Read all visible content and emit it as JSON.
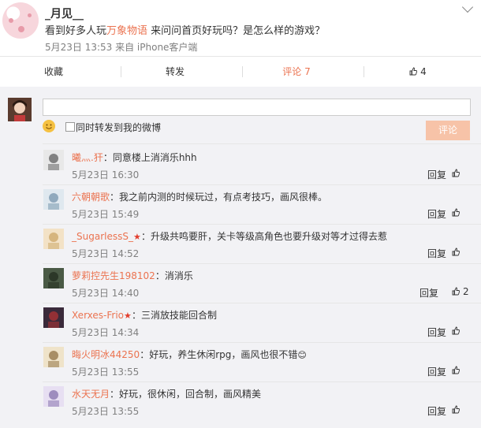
{
  "post": {
    "username": "_月见__",
    "text_before": "看到好多人玩",
    "text_highlight": "万象物语",
    "text_after": " 来问问首页好玩吗？是怎么样的游戏？",
    "meta": "5月23日 13:53 来自 iPhone客户端"
  },
  "actions": {
    "favorite": "收藏",
    "repost": "转发",
    "comment": "评论 7",
    "like_count": "4"
  },
  "composer": {
    "placeholder": "",
    "forward_label": "同时转发到我的微博",
    "submit_label": "评论"
  },
  "comments": [
    {
      "user": "曦灬.犴",
      "vip": false,
      "text": "：同意楼上消消乐hhh",
      "time": "5月23日 16:30",
      "reply": "回复",
      "likes": ""
    },
    {
      "user": "六朝朝歌",
      "vip": false,
      "text": "：我之前内测的时候玩过，有点考技巧，画风很棒。",
      "time": "5月23日 15:49",
      "reply": "回复",
      "likes": ""
    },
    {
      "user": "_SugarlessS_",
      "vip": true,
      "text": "：升级共鸣要肝，关卡等级高角色也要升级对等才过得去惹",
      "time": "5月23日 14:52",
      "reply": "回复",
      "likes": ""
    },
    {
      "user": "萝莉控先生198102",
      "vip": false,
      "text": "：消消乐",
      "time": "5月23日 14:40",
      "reply": "回复",
      "likes": "2"
    },
    {
      "user": "Xerxes-Frio",
      "vip": true,
      "text": "：三消放技能回合制",
      "time": "5月23日 14:34",
      "reply": "回复",
      "likes": ""
    },
    {
      "user": "晦火明冰44250",
      "vip": false,
      "text": "：好玩，养生休闲rpg，画风也很不错",
      "time": "5月23日 13:55",
      "reply": "回复",
      "likes": ""
    },
    {
      "user": "水天无月",
      "vip": false,
      "text": "：好玩，很休闲，回合制，画风精美",
      "time": "5月23日 13:55",
      "reply": "回复",
      "likes": ""
    }
  ],
  "colors": {
    "accent": "#eb7350",
    "panel": "#f2f2f5"
  }
}
